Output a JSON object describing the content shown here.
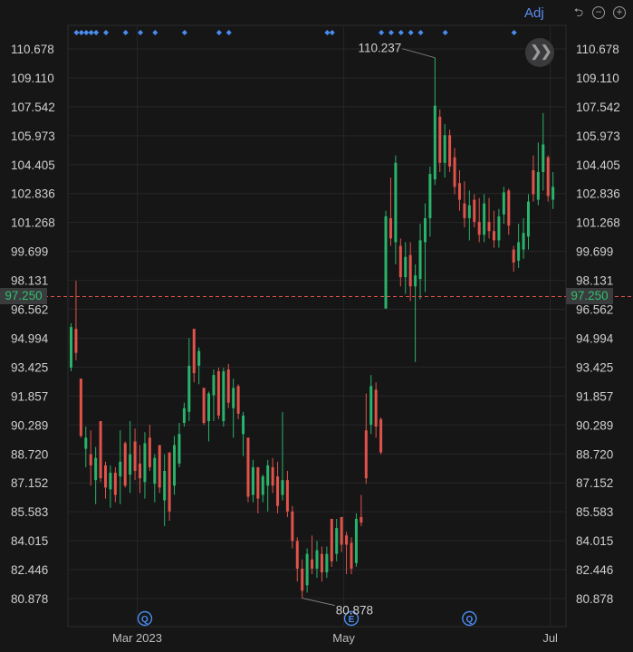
{
  "toolbar": {
    "adj_label": "Adj",
    "icons": [
      "undo-icon",
      "zoom-out-icon",
      "zoom-in-icon"
    ],
    "scroll_icon": "fast-forward-icon"
  },
  "colors": {
    "up": "#2ab36a",
    "down": "#e0534a",
    "current_line": "#e0534a",
    "current_price_text": "#30c070",
    "event_dot": "#4a8df0",
    "badge": "#4a8df0"
  },
  "current_price": {
    "value": 97.25,
    "label": "97.250"
  },
  "annotations": {
    "high_label": "110.237",
    "low_label": "80.878"
  },
  "event_badges": [
    {
      "icon": "q-badge-icon",
      "text": "Q",
      "date": "2023-03-02"
    },
    {
      "icon": "e-badge-icon",
      "text": "E",
      "date": "2023-05-02"
    },
    {
      "icon": "q-badge-icon",
      "text": "Q",
      "date": "2023-06-06"
    }
  ],
  "chart_data": {
    "type": "candlestick",
    "y_ticks": [
      "110.678",
      "109.110",
      "107.542",
      "105.973",
      "104.405",
      "102.836",
      "101.268",
      "99.699",
      "98.131",
      "96.562",
      "94.994",
      "93.425",
      "91.857",
      "90.289",
      "88.720",
      "87.152",
      "85.583",
      "84.015",
      "82.446",
      "80.878"
    ],
    "x_ticks": [
      {
        "label": "Mar 2023",
        "date": "2023-03-01"
      },
      {
        "label": "May",
        "date": "2023-05-01"
      },
      {
        "label": "Jul",
        "date": "2023-07-03"
      }
    ],
    "ylim": [
      80.0,
      112.0
    ],
    "high": 110.237,
    "low": 80.878,
    "event_dot_dates": [
      "2023-02-09",
      "2023-02-10",
      "2023-02-13",
      "2023-02-14",
      "2023-02-15",
      "2023-02-17",
      "2023-02-24",
      "2023-03-01",
      "2023-03-06",
      "2023-03-14",
      "2023-03-23",
      "2023-03-27",
      "2023-04-25",
      "2023-04-26",
      "2023-05-10",
      "2023-05-12",
      "2023-05-16",
      "2023-05-18",
      "2023-05-22",
      "2023-05-30",
      "2023-06-20"
    ],
    "candles": [
      {
        "date": "2023-02-08",
        "o": 93.4,
        "h": 95.8,
        "l": 93.2,
        "c": 95.6
      },
      {
        "date": "2023-02-09",
        "o": 95.5,
        "h": 98.1,
        "l": 93.8,
        "c": 94.2
      },
      {
        "date": "2023-02-10",
        "o": 92.8,
        "h": 92.8,
        "l": 89.6,
        "c": 89.7
      },
      {
        "date": "2023-02-13",
        "o": 89.0,
        "h": 90.2,
        "l": 88.0,
        "c": 89.6
      },
      {
        "date": "2023-02-14",
        "o": 88.7,
        "h": 90.0,
        "l": 87.0,
        "c": 88.1
      },
      {
        "date": "2023-02-15",
        "o": 87.3,
        "h": 89.1,
        "l": 86.0,
        "c": 88.5
      },
      {
        "date": "2023-02-16",
        "o": 90.5,
        "h": 90.5,
        "l": 87.2,
        "c": 87.4
      },
      {
        "date": "2023-02-17",
        "o": 88.1,
        "h": 88.3,
        "l": 86.3,
        "c": 86.9
      },
      {
        "date": "2023-02-21",
        "o": 86.8,
        "h": 88.1,
        "l": 85.8,
        "c": 87.7
      },
      {
        "date": "2023-02-22",
        "o": 87.7,
        "h": 88.0,
        "l": 86.1,
        "c": 86.5
      },
      {
        "date": "2023-02-23",
        "o": 87.5,
        "h": 90.0,
        "l": 86.0,
        "c": 88.3
      },
      {
        "date": "2023-02-24",
        "o": 89.3,
        "h": 89.4,
        "l": 86.9,
        "c": 87.0
      },
      {
        "date": "2023-02-27",
        "o": 87.6,
        "h": 90.5,
        "l": 86.6,
        "c": 88.7
      },
      {
        "date": "2023-02-28",
        "o": 89.4,
        "h": 90.1,
        "l": 87.3,
        "c": 87.8
      },
      {
        "date": "2023-03-01",
        "o": 88.2,
        "h": 89.2,
        "l": 86.6,
        "c": 87.4
      },
      {
        "date": "2023-03-02",
        "o": 87.2,
        "h": 89.9,
        "l": 86.3,
        "c": 89.3
      },
      {
        "date": "2023-03-03",
        "o": 89.6,
        "h": 90.3,
        "l": 87.8,
        "c": 88.0
      },
      {
        "date": "2023-03-06",
        "o": 87.1,
        "h": 88.7,
        "l": 86.1,
        "c": 88.5
      },
      {
        "date": "2023-03-07",
        "o": 89.2,
        "h": 89.2,
        "l": 86.6,
        "c": 86.9
      },
      {
        "date": "2023-03-08",
        "o": 86.2,
        "h": 88.7,
        "l": 84.8,
        "c": 87.8
      },
      {
        "date": "2023-03-09",
        "o": 88.8,
        "h": 88.8,
        "l": 85.1,
        "c": 85.6
      },
      {
        "date": "2023-03-10",
        "o": 87.0,
        "h": 89.7,
        "l": 86.5,
        "c": 89.2
      },
      {
        "date": "2023-03-13",
        "o": 88.2,
        "h": 90.4,
        "l": 88.0,
        "c": 89.8
      },
      {
        "date": "2023-03-14",
        "o": 90.4,
        "h": 91.5,
        "l": 90.2,
        "c": 91.2
      },
      {
        "date": "2023-03-15",
        "o": 91.0,
        "h": 95.0,
        "l": 90.5,
        "c": 93.5
      },
      {
        "date": "2023-03-16",
        "o": 95.5,
        "h": 95.5,
        "l": 92.6,
        "c": 93.1
      },
      {
        "date": "2023-03-17",
        "o": 93.5,
        "h": 94.5,
        "l": 92.5,
        "c": 94.3
      },
      {
        "date": "2023-03-20",
        "o": 92.3,
        "h": 92.3,
        "l": 90.3,
        "c": 90.4
      },
      {
        "date": "2023-03-21",
        "o": 90.5,
        "h": 92.1,
        "l": 89.4,
        "c": 92.0
      },
      {
        "date": "2023-03-22",
        "o": 91.9,
        "h": 93.3,
        "l": 90.5,
        "c": 93.0
      },
      {
        "date": "2023-03-23",
        "o": 93.2,
        "h": 93.4,
        "l": 90.6,
        "c": 90.8
      },
      {
        "date": "2023-03-24",
        "o": 90.5,
        "h": 93.4,
        "l": 90.2,
        "c": 93.2
      },
      {
        "date": "2023-03-27",
        "o": 93.3,
        "h": 93.6,
        "l": 91.2,
        "c": 91.5
      },
      {
        "date": "2023-03-28",
        "o": 91.2,
        "h": 92.8,
        "l": 89.6,
        "c": 92.3
      },
      {
        "date": "2023-03-29",
        "o": 92.4,
        "h": 92.5,
        "l": 90.6,
        "c": 90.9
      },
      {
        "date": "2023-03-30",
        "o": 89.8,
        "h": 91.0,
        "l": 88.6,
        "c": 90.8
      },
      {
        "date": "2023-03-31",
        "o": 89.6,
        "h": 89.6,
        "l": 86.1,
        "c": 86.4
      },
      {
        "date": "2023-04-03",
        "o": 86.5,
        "h": 88.4,
        "l": 86.1,
        "c": 88.0
      },
      {
        "date": "2023-04-04",
        "o": 88.0,
        "h": 88.0,
        "l": 85.5,
        "c": 86.3
      },
      {
        "date": "2023-04-05",
        "o": 86.5,
        "h": 87.6,
        "l": 86.1,
        "c": 87.5
      },
      {
        "date": "2023-04-06",
        "o": 87.0,
        "h": 88.4,
        "l": 85.6,
        "c": 88.1
      },
      {
        "date": "2023-04-10",
        "o": 88.0,
        "h": 88.5,
        "l": 86.6,
        "c": 87.0
      },
      {
        "date": "2023-04-11",
        "o": 87.5,
        "h": 88.3,
        "l": 85.5,
        "c": 85.9
      },
      {
        "date": "2023-04-12",
        "o": 86.5,
        "h": 91.0,
        "l": 86.2,
        "c": 87.3
      },
      {
        "date": "2023-04-13",
        "o": 87.3,
        "h": 87.8,
        "l": 85.3,
        "c": 85.6
      },
      {
        "date": "2023-04-14",
        "o": 85.6,
        "h": 85.9,
        "l": 83.6,
        "c": 84.0
      },
      {
        "date": "2023-04-17",
        "o": 84.0,
        "h": 84.2,
        "l": 81.8,
        "c": 82.5
      },
      {
        "date": "2023-04-18",
        "o": 82.5,
        "h": 83.0,
        "l": 80.9,
        "c": 81.3
      },
      {
        "date": "2023-04-19",
        "o": 81.6,
        "h": 83.6,
        "l": 81.2,
        "c": 83.3
      },
      {
        "date": "2023-04-20",
        "o": 83.0,
        "h": 84.3,
        "l": 82.2,
        "c": 82.5
      },
      {
        "date": "2023-04-21",
        "o": 82.5,
        "h": 84.0,
        "l": 82.0,
        "c": 83.5
      },
      {
        "date": "2023-04-24",
        "o": 83.3,
        "h": 83.7,
        "l": 81.8,
        "c": 82.3
      },
      {
        "date": "2023-04-25",
        "o": 82.3,
        "h": 83.7,
        "l": 82.0,
        "c": 83.3
      },
      {
        "date": "2023-04-26",
        "o": 85.2,
        "h": 85.2,
        "l": 82.6,
        "c": 82.9
      },
      {
        "date": "2023-04-27",
        "o": 83.3,
        "h": 85.2,
        "l": 82.9,
        "c": 84.7
      },
      {
        "date": "2023-04-28",
        "o": 85.3,
        "h": 85.3,
        "l": 83.4,
        "c": 83.8
      },
      {
        "date": "2023-05-01",
        "o": 84.3,
        "h": 84.5,
        "l": 82.2,
        "c": 83.8
      },
      {
        "date": "2023-05-02",
        "o": 83.9,
        "h": 84.2,
        "l": 82.2,
        "c": 82.5
      },
      {
        "date": "2023-05-03",
        "o": 82.8,
        "h": 85.5,
        "l": 82.6,
        "c": 85.2
      },
      {
        "date": "2023-05-04",
        "o": 85.3,
        "h": 86.5,
        "l": 84.8,
        "c": 85.0
      },
      {
        "date": "2023-05-05",
        "o": 90.0,
        "h": 92.0,
        "l": 87.1,
        "c": 87.4
      },
      {
        "date": "2023-05-08",
        "o": 90.3,
        "h": 93.0,
        "l": 89.8,
        "c": 92.4
      },
      {
        "date": "2023-05-09",
        "o": 92.2,
        "h": 92.6,
        "l": 89.6,
        "c": 90.2
      },
      {
        "date": "2023-05-10",
        "o": 90.6,
        "h": 90.7,
        "l": 88.7,
        "c": 88.8
      },
      {
        "date": "2023-05-11",
        "o": 96.6,
        "h": 101.9,
        "l": 96.6,
        "c": 101.6
      },
      {
        "date": "2023-05-12",
        "o": 101.5,
        "h": 103.7,
        "l": 100.0,
        "c": 100.4
      },
      {
        "date": "2023-05-15",
        "o": 100.2,
        "h": 104.9,
        "l": 99.0,
        "c": 104.5
      },
      {
        "date": "2023-05-16",
        "o": 100.0,
        "h": 100.4,
        "l": 97.8,
        "c": 98.3
      },
      {
        "date": "2023-05-17",
        "o": 98.3,
        "h": 100.2,
        "l": 97.4,
        "c": 99.4
      },
      {
        "date": "2023-05-18",
        "o": 99.5,
        "h": 100.2,
        "l": 97.0,
        "c": 97.8
      },
      {
        "date": "2023-05-19",
        "o": 97.8,
        "h": 99.0,
        "l": 93.7,
        "c": 98.4
      },
      {
        "date": "2023-05-22",
        "o": 98.2,
        "h": 101.2,
        "l": 97.1,
        "c": 100.3
      },
      {
        "date": "2023-05-23",
        "o": 100.2,
        "h": 102.3,
        "l": 97.5,
        "c": 101.5
      },
      {
        "date": "2023-05-24",
        "o": 101.5,
        "h": 104.3,
        "l": 100.5,
        "c": 103.9
      },
      {
        "date": "2023-05-25",
        "o": 103.6,
        "h": 110.2,
        "l": 103.3,
        "c": 107.6
      },
      {
        "date": "2023-05-26",
        "o": 107.0,
        "h": 107.4,
        "l": 104.0,
        "c": 104.5
      },
      {
        "date": "2023-05-30",
        "o": 104.5,
        "h": 106.6,
        "l": 103.7,
        "c": 106.0
      },
      {
        "date": "2023-05-31",
        "o": 106.0,
        "h": 106.3,
        "l": 104.0,
        "c": 104.3
      },
      {
        "date": "2023-06-01",
        "o": 104.8,
        "h": 105.3,
        "l": 102.8,
        "c": 103.2
      },
      {
        "date": "2023-06-02",
        "o": 103.4,
        "h": 104.1,
        "l": 101.9,
        "c": 102.5
      },
      {
        "date": "2023-06-05",
        "o": 102.3,
        "h": 103.5,
        "l": 101.0,
        "c": 101.5
      },
      {
        "date": "2023-06-06",
        "o": 101.5,
        "h": 103.0,
        "l": 100.3,
        "c": 102.2
      },
      {
        "date": "2023-06-07",
        "o": 102.5,
        "h": 102.8,
        "l": 101.0,
        "c": 101.3
      },
      {
        "date": "2023-06-08",
        "o": 101.3,
        "h": 102.6,
        "l": 100.2,
        "c": 100.6
      },
      {
        "date": "2023-06-09",
        "o": 100.6,
        "h": 102.8,
        "l": 100.2,
        "c": 102.3
      },
      {
        "date": "2023-06-12",
        "o": 101.3,
        "h": 102.6,
        "l": 100.4,
        "c": 100.8
      },
      {
        "date": "2023-06-13",
        "o": 100.8,
        "h": 101.9,
        "l": 99.9,
        "c": 100.3
      },
      {
        "date": "2023-06-14",
        "o": 100.3,
        "h": 102.0,
        "l": 99.9,
        "c": 101.6
      },
      {
        "date": "2023-06-15",
        "o": 101.7,
        "h": 103.2,
        "l": 101.2,
        "c": 102.9
      },
      {
        "date": "2023-06-16",
        "o": 103.0,
        "h": 103.1,
        "l": 100.6,
        "c": 101.1
      },
      {
        "date": "2023-06-20",
        "o": 99.8,
        "h": 100.0,
        "l": 98.6,
        "c": 99.1
      },
      {
        "date": "2023-06-21",
        "o": 99.2,
        "h": 101.2,
        "l": 98.8,
        "c": 100.2
      },
      {
        "date": "2023-06-22",
        "o": 99.8,
        "h": 101.5,
        "l": 99.3,
        "c": 100.7
      },
      {
        "date": "2023-06-23",
        "o": 100.5,
        "h": 102.8,
        "l": 99.8,
        "c": 102.4
      },
      {
        "date": "2023-06-26",
        "o": 104.1,
        "h": 104.9,
        "l": 102.4,
        "c": 102.8
      },
      {
        "date": "2023-06-27",
        "o": 102.5,
        "h": 105.6,
        "l": 102.2,
        "c": 104.0
      },
      {
        "date": "2023-06-28",
        "o": 104.0,
        "h": 107.2,
        "l": 103.0,
        "c": 105.5
      },
      {
        "date": "2023-06-29",
        "o": 104.8,
        "h": 104.9,
        "l": 102.4,
        "c": 102.7
      },
      {
        "date": "2023-06-30",
        "o": 102.5,
        "h": 104.0,
        "l": 102.0,
        "c": 103.2
      }
    ]
  }
}
